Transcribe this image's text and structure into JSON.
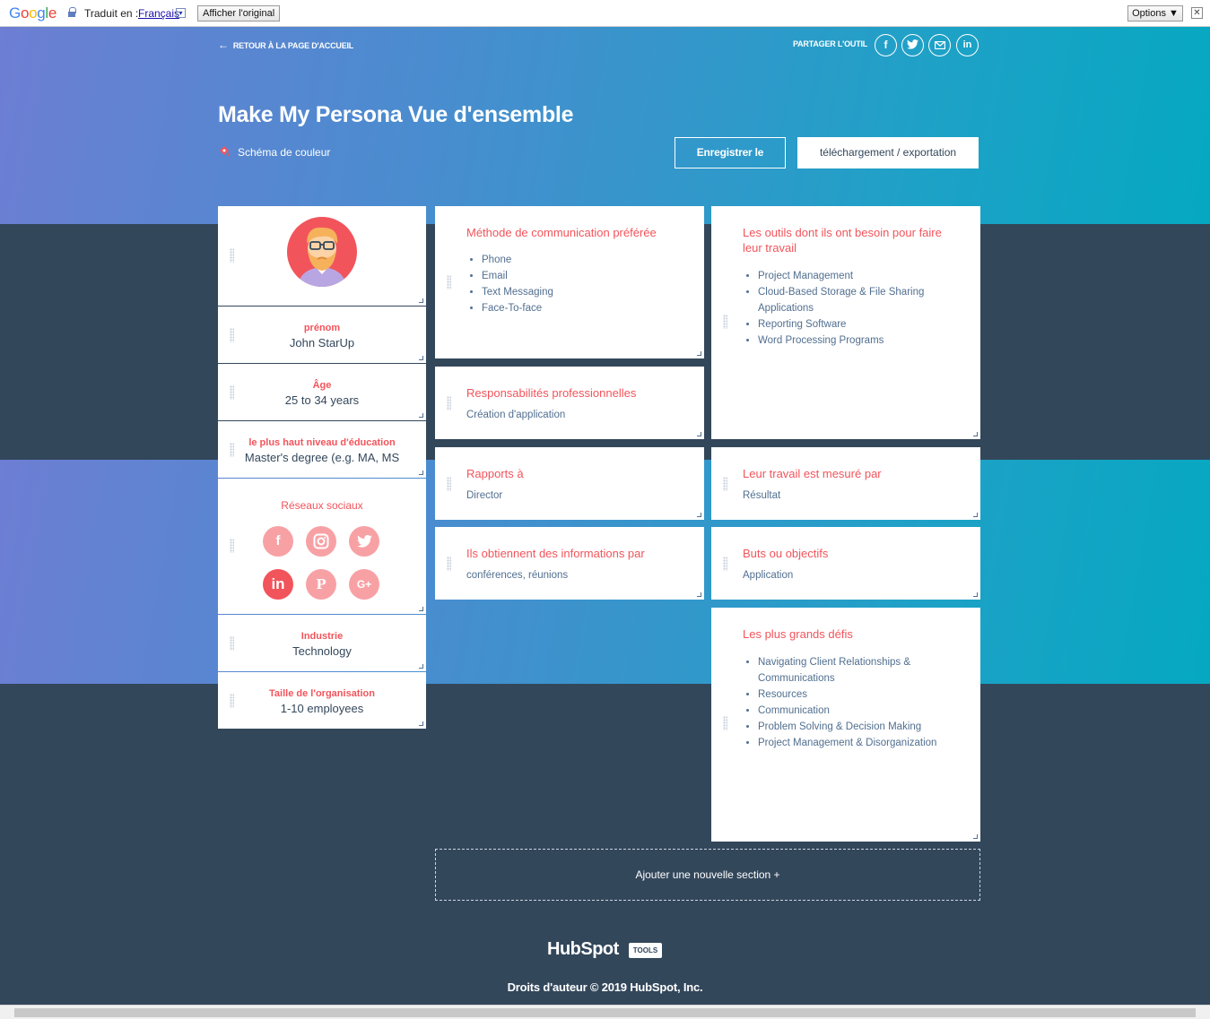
{
  "translate_bar": {
    "logo": "Google",
    "translated_to": "Traduit en :",
    "language": "Français",
    "show_original": "Afficher l'original",
    "options": "Options ▼",
    "close": "✕"
  },
  "header": {
    "back_link": "RETOUR À LA PAGE D'ACCUEIL",
    "share_label": "PARTAGER L'OUTIL",
    "share_icons": [
      "facebook-icon",
      "twitter-icon",
      "email-icon",
      "linkedin-icon"
    ],
    "title": "Make My Persona Vue d'ensemble",
    "color_scheme": "Schéma de couleur",
    "save_button": "Enregistrer le",
    "download_button": "téléchargement / exportation"
  },
  "persona": {
    "first_name_label": "prénom",
    "first_name": "John StarUp",
    "age_label": "Âge",
    "age": "25 to 34 years",
    "education_label": "le plus haut niveau d'éducation",
    "education": "Master's degree (e.g. MA, MS",
    "social_label": "Réseaux sociaux",
    "social_networks": [
      {
        "icon": "facebook-icon",
        "glyph": "f",
        "selected": false
      },
      {
        "icon": "instagram-icon",
        "glyph": "◎",
        "selected": false
      },
      {
        "icon": "twitter-icon",
        "glyph": "t",
        "selected": false
      },
      {
        "icon": "linkedin-icon",
        "glyph": "in",
        "selected": true
      },
      {
        "icon": "pinterest-icon",
        "glyph": "P",
        "selected": false
      },
      {
        "icon": "google-plus-icon",
        "glyph": "G+",
        "selected": false
      }
    ],
    "industry_label": "Industrie",
    "industry": "Technology",
    "org_size_label": "Taille de l'organisation",
    "org_size": "1-10 employees"
  },
  "sections": {
    "communication": {
      "title": "Méthode de communication préférée",
      "items": [
        "Phone",
        "Email",
        "Text Messaging",
        "Face-To-face"
      ]
    },
    "tools": {
      "title": "Les outils dont ils ont besoin pour faire leur travail",
      "items": [
        "Project Management",
        "Cloud-Based Storage & File Sharing Applications",
        "Reporting Software",
        "Word Processing Programs"
      ]
    },
    "responsibilities": {
      "title": "Responsabilités professionnelles",
      "text": "Création d'application"
    },
    "reports_to": {
      "title": "Rapports à",
      "text": "Director"
    },
    "measured_by": {
      "title": "Leur travail est mesuré par",
      "text": "Résultat"
    },
    "info_sources": {
      "title": "Ils obtiennent des informations par",
      "text": "conférences, réunions"
    },
    "goals": {
      "title": "Buts ou objectifs",
      "text": "Application"
    },
    "challenges": {
      "title": "Les plus grands défis",
      "items": [
        "Navigating Client Relationships & Communications",
        "Resources",
        "Communication",
        "Problem Solving & Decision Making",
        "Project Management & Disorganization"
      ]
    }
  },
  "add_section": "Ajouter une nouvelle section +",
  "footer": {
    "brand": "HubSpot",
    "tools_badge": "TOOLS",
    "copyright": "Droits d'auteur © 2019 HubSpot, Inc."
  },
  "colors": {
    "accent": "#f2545b",
    "dark": "#33475b",
    "gradient_start": "#6d7ed3",
    "gradient_end": "#05a8c1"
  }
}
